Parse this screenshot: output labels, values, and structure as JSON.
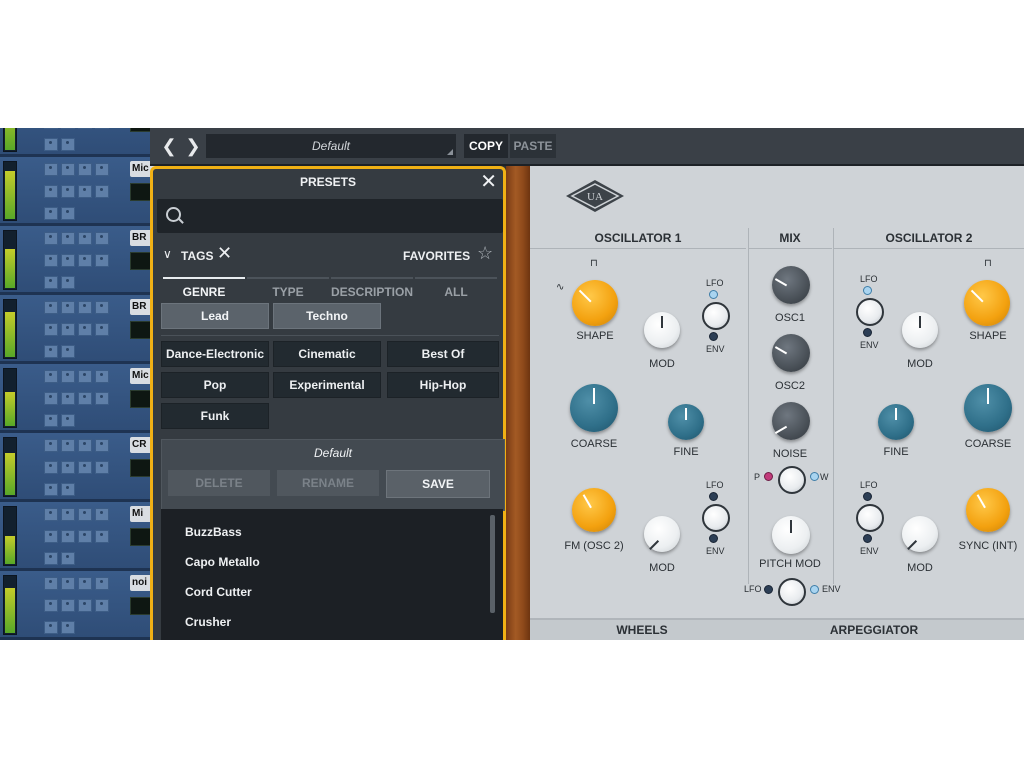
{
  "mixer": {
    "channels": [
      {
        "tag": ""
      },
      {
        "tag": "Mic"
      },
      {
        "tag": "BR"
      },
      {
        "tag": "BR"
      },
      {
        "tag": "Mic"
      },
      {
        "tag": "CR"
      },
      {
        "tag": "Mi"
      },
      {
        "tag": "noi"
      }
    ]
  },
  "toolbar": {
    "preset_name": "Default",
    "copy_label": "COPY",
    "paste_label": "PASTE"
  },
  "presets": {
    "title": "PRESETS",
    "search_placeholder": "",
    "tags_label": "TAGS",
    "favorites_label": "FAVORITES",
    "tabs": [
      "GENRE",
      "TYPE",
      "DESCRIPTION",
      "ALL"
    ],
    "selected_tags": [
      "Lead",
      "Techno"
    ],
    "genre_tags": [
      "Dance-Electronic",
      "Cinematic",
      "Best Of",
      "Pop",
      "Experimental",
      "Hip-Hop",
      "Funk"
    ],
    "current_preset": "Default",
    "delete_label": "DELETE",
    "rename_label": "RENAME",
    "save_label": "SAVE",
    "list": [
      "BuzzBass",
      "Capo Metallo",
      "Cord Cutter",
      "Crusher"
    ]
  },
  "synth": {
    "sections": {
      "osc1": "OSCILLATOR 1",
      "mix": "MIX",
      "osc2": "OSCILLATOR 2",
      "wheels": "WHEELS",
      "arpeggiator": "ARPEGGIATOR"
    },
    "labels": {
      "shape": "SHAPE",
      "mod": "MOD",
      "coarse": "COARSE",
      "fine": "FINE",
      "fm": "FM (OSC 2)",
      "sync": "SYNC (INT)",
      "osc1": "OSC1",
      "osc2": "OSC2",
      "noise": "NOISE",
      "pitch_mod": "PITCH MOD",
      "lfo": "LFO",
      "env": "ENV",
      "p": "P",
      "w": "W"
    }
  }
}
